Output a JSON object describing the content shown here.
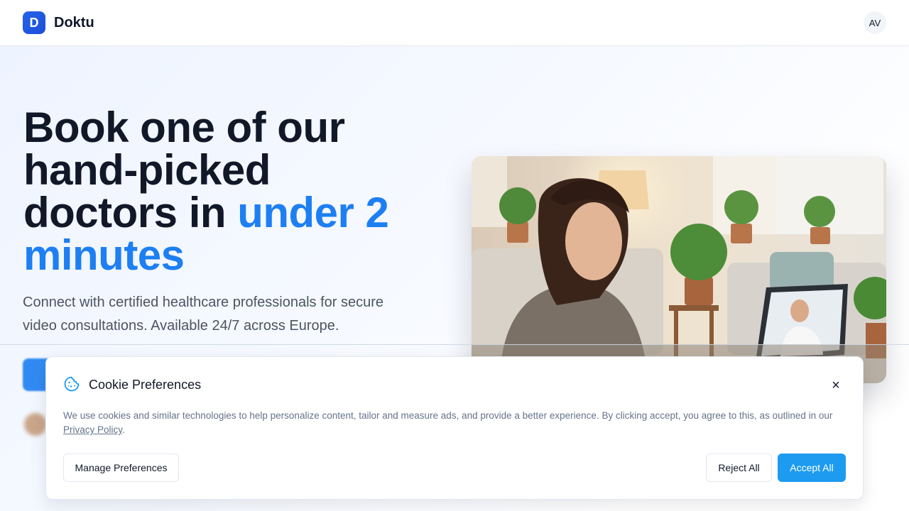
{
  "brand": {
    "logo_letter": "D",
    "name": "Doktu"
  },
  "user": {
    "initials": "AV"
  },
  "hero": {
    "title_part1": "Book one of our hand-picked doctors in ",
    "title_accent": "under 2 minutes",
    "subtitle": "Connect with certified healthcare professionals for secure video consultations. Available 24/7 across Europe."
  },
  "cookie": {
    "title": "Cookie Preferences",
    "close_label": "×",
    "text_before_link": "We use cookies and similar technologies to help personalize content, tailor and measure ads, and provide a better experience. By clicking accept, you agree to this, as outlined in our ",
    "link_text": "Privacy Policy",
    "text_after_link": ".",
    "manage_label": "Manage Preferences",
    "reject_label": "Reject All",
    "accept_label": "Accept All"
  },
  "icons": {
    "cookie": "cookie-icon",
    "close": "close-icon"
  },
  "colors": {
    "accent": "#1d7ff2",
    "button_primary": "#1d9bf0",
    "logo_bg": "#2563eb"
  }
}
